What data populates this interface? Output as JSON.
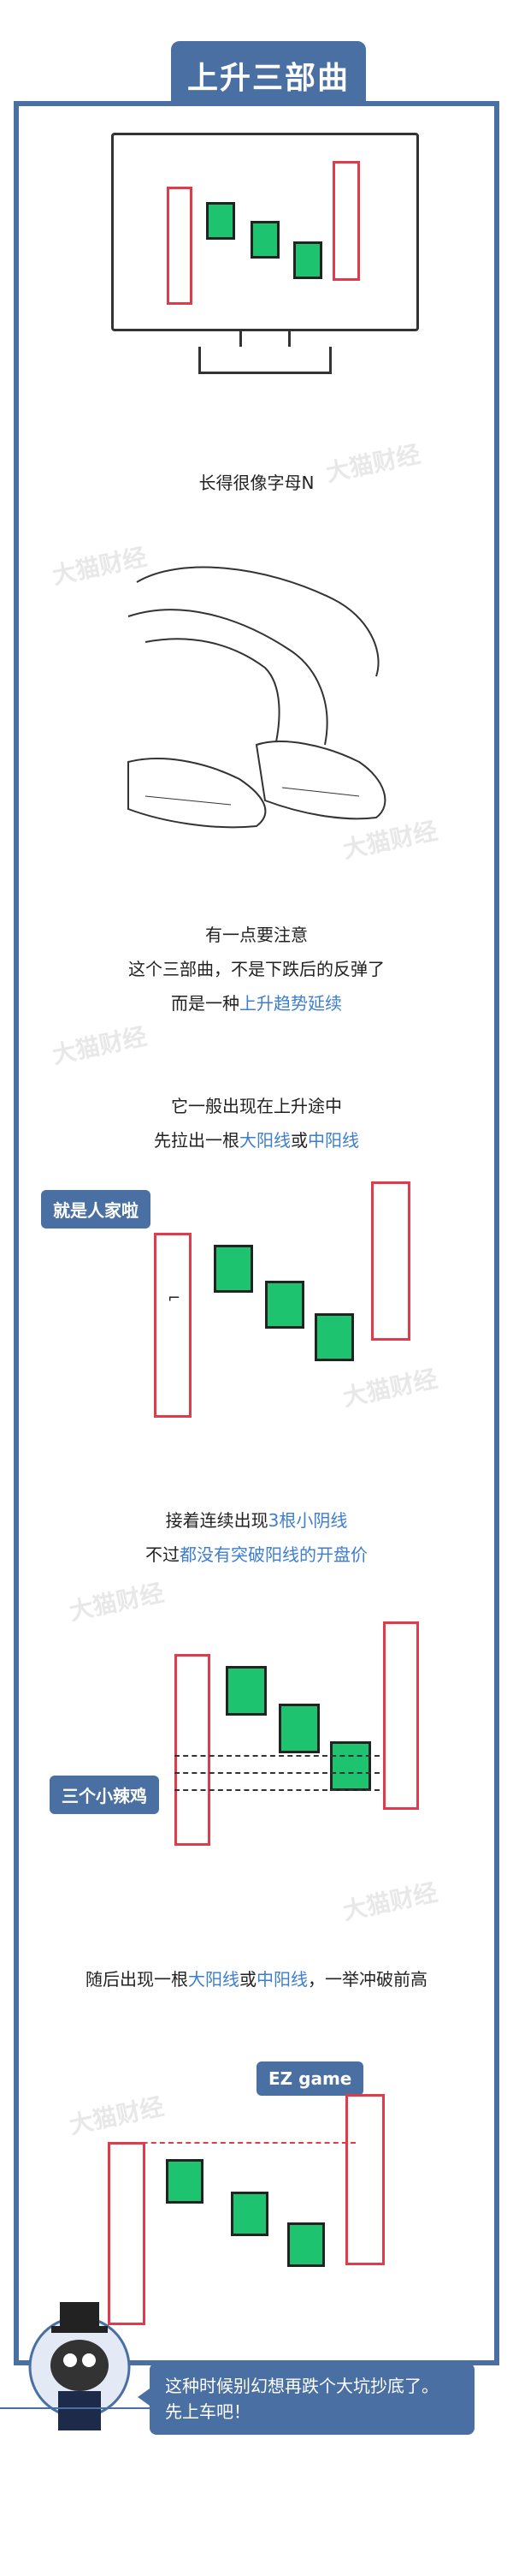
{
  "title": "上升三部曲",
  "watermark": "大猫财经",
  "text1": "长得很像字母N",
  "para2": {
    "line1": "有一点要注意",
    "line2": "这个三部曲，不是下跌后的反弹了",
    "line3_prefix": "而是一种",
    "line3_hl": "上升趋势延续"
  },
  "para3": {
    "line1": "它一般出现在上升途中",
    "line2_prefix": "先拉出一根",
    "line2_hl1": "大阳线",
    "line2_mid": "或",
    "line2_hl2": "中阳线"
  },
  "bubble1": "就是人家啦",
  "para4": {
    "line1_prefix": "接着连续出现",
    "line1_hl": "3根小阴线",
    "line2_prefix": "不过",
    "line2_hl": "都没有突破阳线的开盘价"
  },
  "bubble2": "三个小辣鸡",
  "para5": {
    "prefix": "随后出现一根",
    "hl1": "大阳线",
    "mid": "或",
    "hl2": "中阳线",
    "suffix": "，一举冲破前高"
  },
  "bubble3": "EZ game",
  "footer": {
    "line1": "这种时候别幻想再跌个大坑抄底了。",
    "line2": "先上车吧！"
  },
  "colors": {
    "frame": "#4a6fa2",
    "highlight": "#3d7ed1",
    "red": "#e03b4b",
    "green": "#1ec36f"
  }
}
